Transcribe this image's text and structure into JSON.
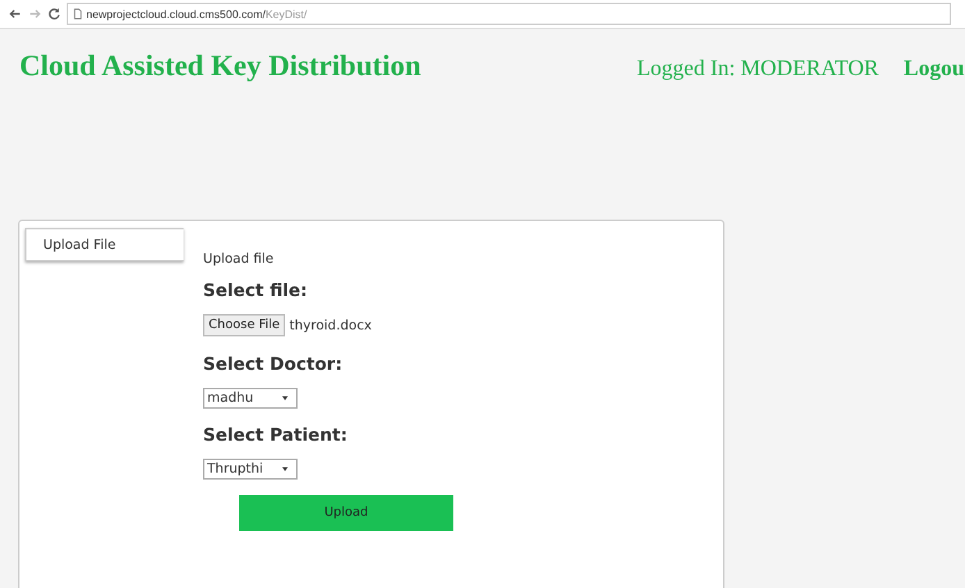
{
  "browser": {
    "url_host": "newprojectcloud.cloud.cms500.com/",
    "url_path": "KeyDist/"
  },
  "header": {
    "title": "Cloud Assisted Key Distribution",
    "login_status": "Logged In: MODERATOR",
    "logout_link": "Logou"
  },
  "tabs": [
    {
      "label": "Upload File",
      "selected": true
    }
  ],
  "form": {
    "heading": "Upload file",
    "file_label": "Select file:",
    "choose_button": "Choose File",
    "file_name": "thyroid.docx",
    "doctor_label": "Select Doctor:",
    "doctor_value": "madhu",
    "patient_label": "Select Patient:",
    "patient_value": "Thrupthi",
    "submit": "Upload"
  }
}
